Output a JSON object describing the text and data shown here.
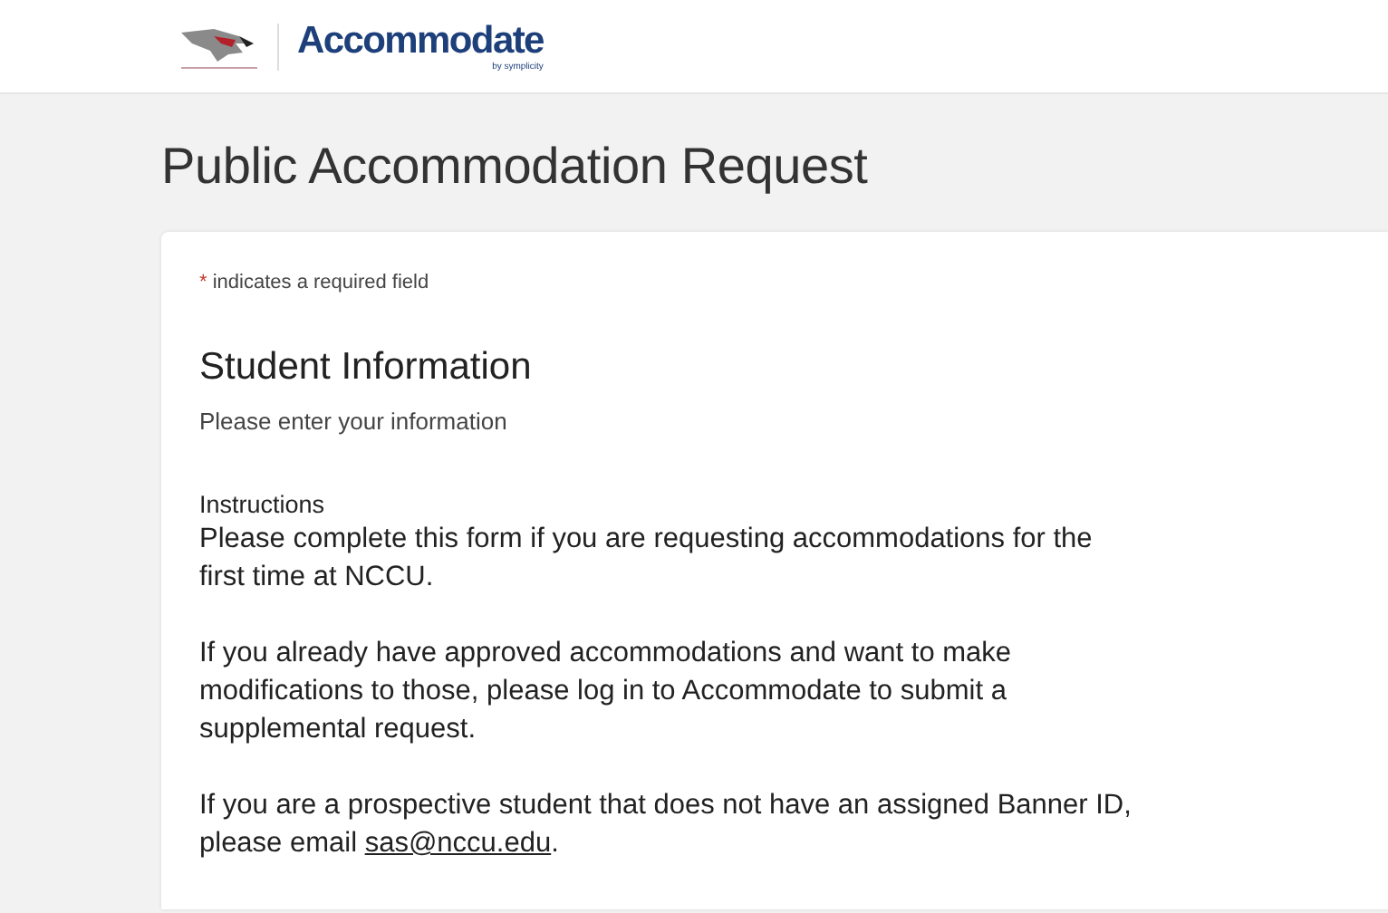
{
  "header": {
    "logo_text": "Accommodate",
    "logo_byline": "by symplicity"
  },
  "page_title": "Public Accommodation Request",
  "form": {
    "required_mark": "*",
    "required_note": "indicates a required field",
    "section_title": "Student Information",
    "section_subtitle": "Please enter your information",
    "instructions_label": "Instructions",
    "paragraphs": [
      {
        "text": "Please complete this form if you are requesting accommodations for the first time at NCCU."
      },
      {
        "text": "If you already have approved accommodations and want to make modifications to those, please log in to Accommodate to submit a supplemental request."
      },
      {
        "text": "If you are a prospective student that does not have an assigned Banner ID, please email ",
        "link": "sas@nccu.edu",
        "after": "."
      }
    ]
  }
}
